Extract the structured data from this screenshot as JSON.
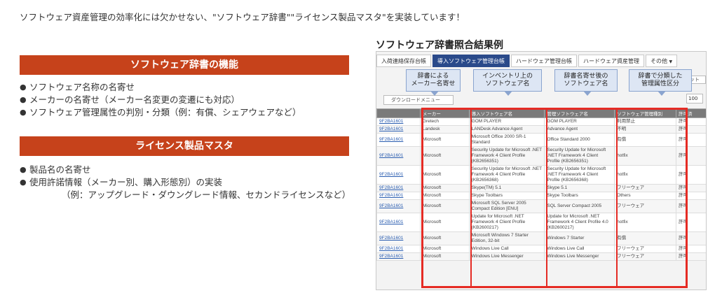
{
  "intro": "ソフトウェア資産管理の効率化には欠かせない、\"ソフトウェア辞書\"\"ライセンス製品マスタ\"を実装しています！",
  "left": {
    "section1": {
      "title": "ソフトウェア辞書の機能",
      "items": [
        "ソフトウェア名称の名寄せ",
        "メーカーの名寄せ（メーカー名変更の変遷にも対応）",
        "ソフトウェア管理属性の判別・分類（例：有償、シェアウェアなど）"
      ]
    },
    "section2": {
      "title": "ライセンス製品マスタ",
      "items": [
        "製品名の名寄せ",
        "使用許諾情報（メーカー別、購入形態別）の実装"
      ],
      "sub": "（例：アップグレード・ダウングレード情報、セカンドライセンスなど）"
    }
  },
  "screenshot": {
    "title": "ソフトウェア辞書照合結果例",
    "tabs": [
      "入荷連絡保存台帳",
      "導入ソフトウェア管理台帳",
      "ハードウェア管理台帳",
      "ハードウェア資産管理",
      "その他"
    ],
    "download_label": "ダウンロードメニュー",
    "search_input": "ット",
    "per_page": "100",
    "callouts": [
      "辞書による\nメーカー名寄せ",
      "インベントリ上の\nソフトウェア名",
      "辞書名寄せ後の\nソフトウェア名",
      "辞書で分類した\n管理属性区分"
    ],
    "columns": [
      "",
      "メーカー",
      "導入ソフトウェア名",
      "管理ソフトウェア名",
      "ソフトウェア管理種別",
      "許可済"
    ],
    "rows": [
      [
        "9F2BA1601",
        "Gretech",
        "GOM PLAYER",
        "GOM PLAYER",
        "利用禁止",
        "許可"
      ],
      [
        "9F2BA1601",
        "Landesk",
        "LANDesk Advance Agent",
        "Advance Agent",
        "不明",
        "許可"
      ],
      [
        "9F2BA1601",
        "Microsoft",
        "Microsoft Office 2000 SR-1 Standard",
        "Office Standard 2000",
        "有償",
        "許可"
      ],
      [
        "9F2BA1601",
        "Microsoft",
        "Security Update for Microsoft .NET Framework 4 Client Profile (KB2656351)",
        "Security Update for Microsoft .NET Framework 4 Client Profile (KB2656351)",
        "hotfix",
        "許可"
      ],
      [
        "9F2BA1601",
        "Microsoft",
        "Security Update for Microsoft .NET Framework 4 Client Profile (KB2656368)",
        "Security Update for Microsoft .NET Framework 4 Client Profile (KB2656368)",
        "hotfix",
        "許可"
      ],
      [
        "9F2BA1601",
        "Microsoft",
        "Skype(TM) 5.1",
        "Skype 5.1",
        "フリーウェア",
        "許可"
      ],
      [
        "9F2BA1601",
        "Microsoft",
        "Skype Toolbars",
        "Skype Toolbars",
        "Others",
        "許可"
      ],
      [
        "9F2BA1601",
        "Microsoft",
        "Microsoft SQL Server 2005 Compact Edition [ENU]",
        "SQL Server Compact 2005",
        "フリーウェア",
        "許可"
      ],
      [
        "9F2BA1601",
        "Microsoft",
        "Update for Microsoft .NET Framework 4 Client Profile (KB2600217)",
        "Update for Microsoft .NET Framework 4 Client Profile 4.0 (KB2600217)",
        "hotfix",
        "許可"
      ],
      [
        "9F2BA1601",
        "Microsoft",
        "Microsoft Windows 7 Starter Edition, 32-bit",
        "Windows 7 Starter",
        "有償",
        "許可"
      ],
      [
        "9F2BA1601",
        "Microsoft",
        "Windows Live Call",
        "Windows Live Call",
        "フリーウェア",
        "許可"
      ],
      [
        "9F2BA1601",
        "Microsoft",
        "Windows Live Messenger",
        "Windows Live Messenger",
        "フリーウェア",
        "許可"
      ]
    ]
  }
}
